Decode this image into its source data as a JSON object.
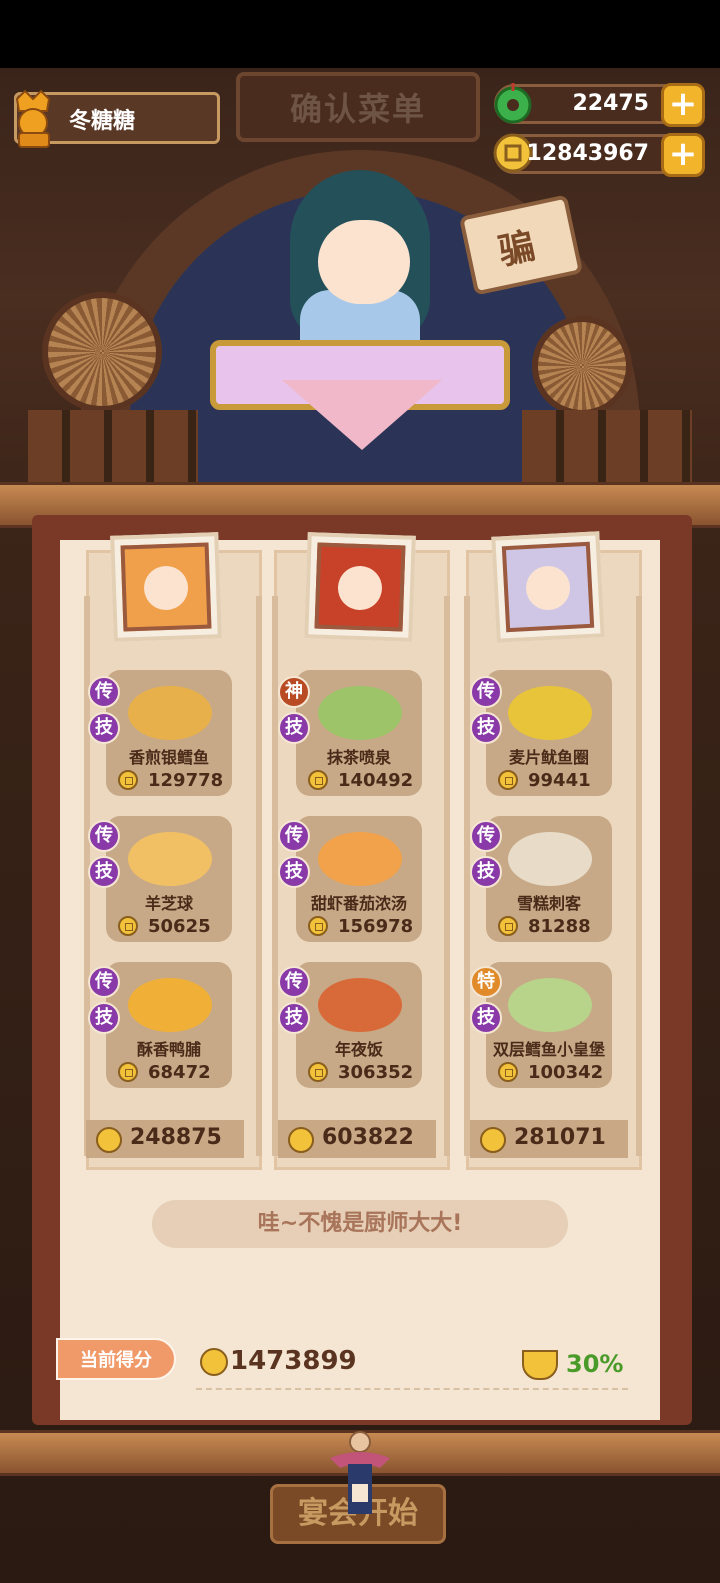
{
  "player": {
    "name": "冬糖糖"
  },
  "header": {
    "banner": "确认菜单"
  },
  "currency": [
    {
      "icon": "jade-icon",
      "value": "22475"
    },
    {
      "icon": "coin-icon",
      "value": "12843967"
    }
  ],
  "stage": {
    "sign_text": "骗"
  },
  "chefs": [
    {
      "dishes": [
        {
          "badge": "传",
          "name": "香煎银鳕鱼",
          "value": "129778",
          "food_color": "#e8b04a"
        },
        {
          "badge": "传",
          "name": "羊芝球",
          "value": "50625",
          "food_color": "#f2c064"
        },
        {
          "badge": "传",
          "name": "酥香鸭脯",
          "value": "68472",
          "food_color": "#f0b038"
        }
      ],
      "skill": "技",
      "total": "248875"
    },
    {
      "dishes": [
        {
          "badge": "神",
          "name": "抹茶喷泉",
          "value": "140492",
          "food_color": "#9ec46a"
        },
        {
          "badge": "传",
          "name": "甜虾番茄浓汤",
          "value": "156978",
          "food_color": "#f2a24a"
        },
        {
          "badge": "传",
          "name": "年夜饭",
          "value": "306352",
          "food_color": "#d86a3a"
        }
      ],
      "skill": "技",
      "total": "603822"
    },
    {
      "dishes": [
        {
          "badge": "传",
          "name": "麦片鱿鱼圈",
          "value": "99441",
          "food_color": "#e8c43a"
        },
        {
          "badge": "传",
          "name": "雪糕刺客",
          "value": "81288",
          "food_color": "#e8dcc8"
        },
        {
          "badge": "特",
          "name": "双层鳕鱼小皇堡",
          "value": "100342",
          "food_color": "#b8d48a"
        }
      ],
      "skill": "技",
      "total": "281071"
    }
  ],
  "message": "哇~不愧是厨师大大!",
  "score": {
    "label": "当前得分",
    "value": "1473899",
    "bonus": "30%"
  },
  "start_button": "宴会开始"
}
